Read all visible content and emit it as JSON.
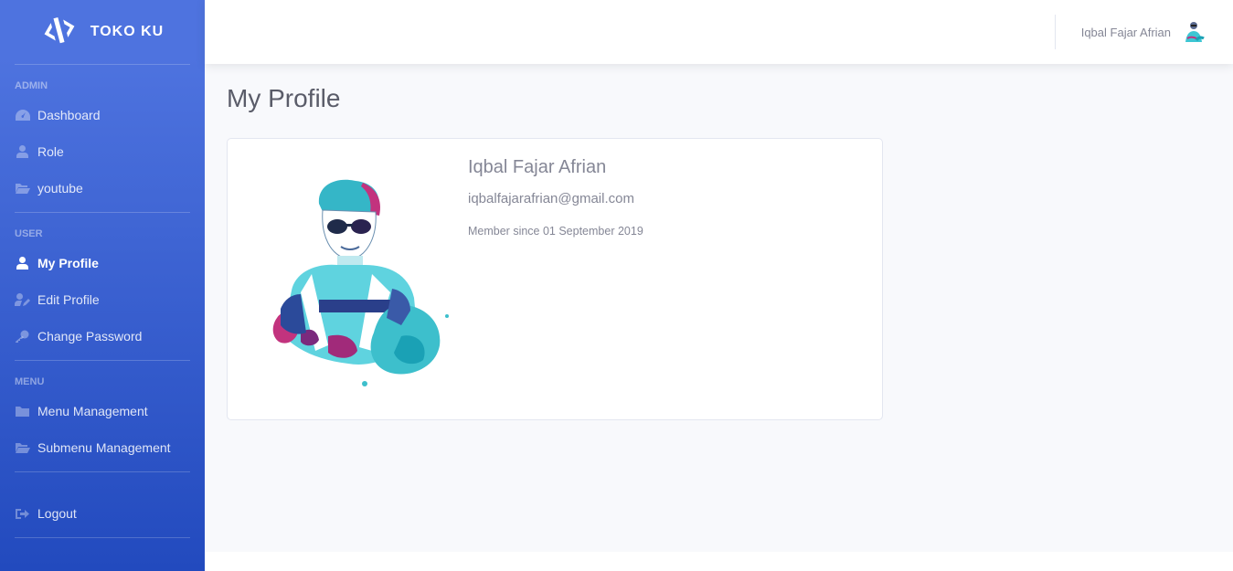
{
  "brand": {
    "name": "TOKO KU",
    "icon": "code-icon"
  },
  "sidebar": {
    "sections": [
      {
        "heading": "ADMIN",
        "items": [
          {
            "label": "Dashboard",
            "icon": "tachometer-icon"
          },
          {
            "label": "Role",
            "icon": "user-tie-icon"
          },
          {
            "label": "youtube",
            "icon": "folder-open-icon"
          }
        ]
      },
      {
        "heading": "USER",
        "items": [
          {
            "label": "My Profile",
            "icon": "user-icon",
            "active": true
          },
          {
            "label": "Edit Profile",
            "icon": "user-edit-icon"
          },
          {
            "label": "Change Password",
            "icon": "key-icon"
          }
        ]
      },
      {
        "heading": "MENU",
        "items": [
          {
            "label": "Menu Management",
            "icon": "folder-icon"
          },
          {
            "label": "Submenu Management",
            "icon": "folder-open-icon"
          }
        ]
      }
    ],
    "logout": {
      "label": "Logout",
      "icon": "sign-out-icon"
    }
  },
  "topbar": {
    "user_name": "Iqbal Fajar Afrian"
  },
  "main": {
    "title": "My Profile",
    "profile": {
      "name": "Iqbal Fajar Afrian",
      "email": "iqbalfajarafrian@gmail.com",
      "member_since": "Member since 01 September 2019"
    }
  },
  "colors": {
    "sidebar_start": "#4e73df",
    "sidebar_end": "#224abe",
    "text_muted": "#858796",
    "title": "#5a5c69"
  }
}
